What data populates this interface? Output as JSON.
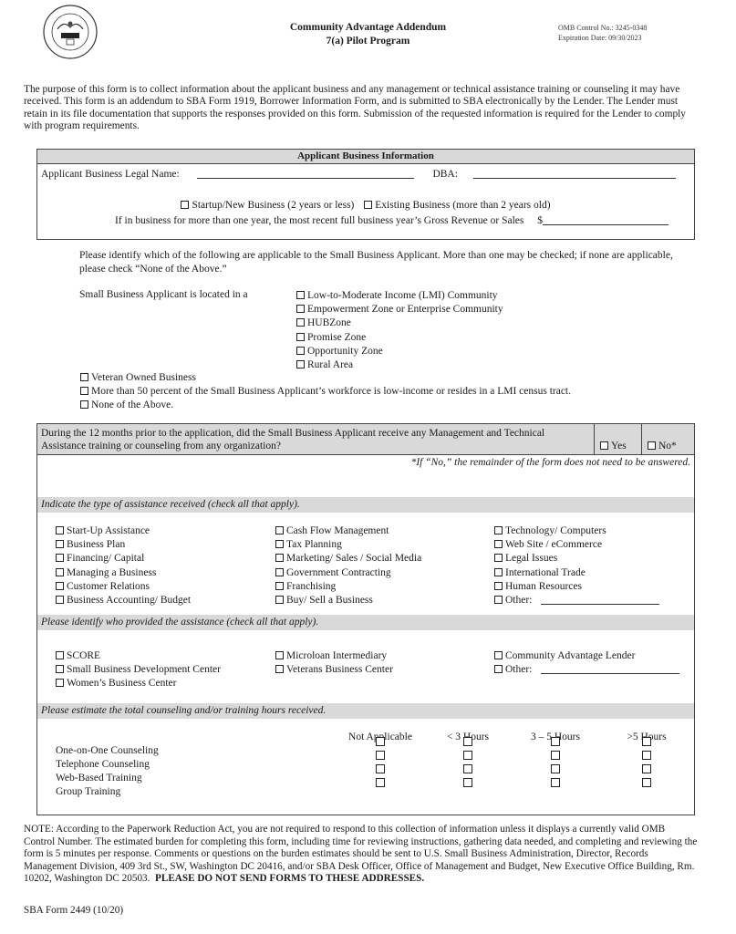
{
  "header": {
    "seal_icon": "sba-seal-icon",
    "title_line1": "Community Advantage Addendum",
    "title_line2": "7(a) Pilot Program",
    "omb_control": "OMB Control No.: 3245-0348",
    "expiration": "Expiration Date: 09/30/2023"
  },
  "intro": "The purpose of this form is to collect information about the applicant business and any management or technical assistance training or counseling it may have received. This form is an addendum to SBA Form 1919, Borrower Information Form, and is submitted to SBA electronically by the Lender. The Lender must retain in its file documentation that supports the responses provided on this form. Submission of the requested information is required for the Lender to comply with program requirements.",
  "applicant": {
    "section_title": "Applicant Business Information",
    "legal_name_label": "Applicant Business Legal Name:",
    "legal_name_value": "",
    "dba_label": "DBA:",
    "dba_value": "",
    "startup_label": "Startup/New Business (2 years or less)",
    "existing_label": "Existing Business (more than 2 years old)",
    "revenue_label": "If in business for more than one year, the most recent full business year’s Gross Revenue or Sales",
    "currency_symbol": "$",
    "revenue_value": ""
  },
  "applicability": {
    "instructions": "Please identify which of the following are applicable to the Small Business Applicant.  More than one may be checked; if none are applicable, please check “None of the Above.”",
    "located_label": "Small Business Applicant is located in a",
    "locations": [
      "Low-to-Moderate Income (LMI) Community",
      "Empowerment Zone or Enterprise Community",
      "HUBZone",
      "Promise Zone",
      "Opportunity Zone",
      "Rural Area"
    ],
    "other": [
      "Veteran Owned Business",
      "More than 50 percent of the Small Business Applicant’s workforce is low-income or resides in a LMI census tract.",
      "None of the Above."
    ]
  },
  "assistance": {
    "question": "During the 12 months prior to the application, did the Small Business Applicant receive any Management and Technical Assistance training or counseling from any organization?",
    "yes_label": "Yes",
    "no_label": "No*",
    "no_note": "*If “No,” the remainder of the form does not need to be answered.",
    "type_band": "Indicate the type of assistance received (check all that apply).",
    "types": [
      [
        "Start-Up Assistance",
        "Business Plan",
        "Financing/ Capital",
        "Managing a Business",
        "Customer Relations",
        "Business Accounting/ Budget"
      ],
      [
        "Cash Flow Management",
        "Tax Planning",
        "Marketing/ Sales / Social Media",
        "Government Contracting",
        "Franchising",
        "Buy/ Sell a Business"
      ],
      [
        "Technology/ Computers",
        "Web Site / eCommerce",
        "Legal Issues",
        "International Trade",
        "Human Resources",
        "Other:"
      ]
    ],
    "provider_band": "Please identify who provided the assistance (check all that apply).",
    "providers": [
      [
        "SCORE",
        "Small Business Development Center",
        "Women’s Business Center"
      ],
      [
        "Microloan Intermediary",
        "Veterans Business Center"
      ],
      [
        "Community Advantage Lender",
        "Other:"
      ]
    ],
    "hours_band": "Please estimate the total counseling and/or training hours received.",
    "hours_columns": [
      "Not Applicable",
      "< 3 Hours",
      "3 – 5 Hours",
      ">5 Hours"
    ],
    "hours_rows": [
      "One-on-One Counseling",
      "Telephone Counseling",
      "Web-Based Training",
      "Group Training"
    ]
  },
  "footer": {
    "note": "NOTE: According to the Paperwork Reduction Act, you are not required to respond to this collection of information unless it displays a currently valid OMB Control Number. The estimated burden for completing this form, including time for reviewing instructions, gathering data needed, and completing and reviewing the form is 5 minutes per response. Comments or questions on the burden estimates should be sent to U.S. Small Business Administration, Director, Records Management Division, 409 3rd St., SW, Washington DC 20416, and/or SBA Desk Officer, Office of Management and Budget, New Executive Office Building, Rm. 10202, Washington DC 20503.",
    "note_bold": "PLEASE DO NOT SEND FORMS TO THESE ADDRESSES.",
    "form_number": "SBA Form 2449 (10/20)"
  }
}
